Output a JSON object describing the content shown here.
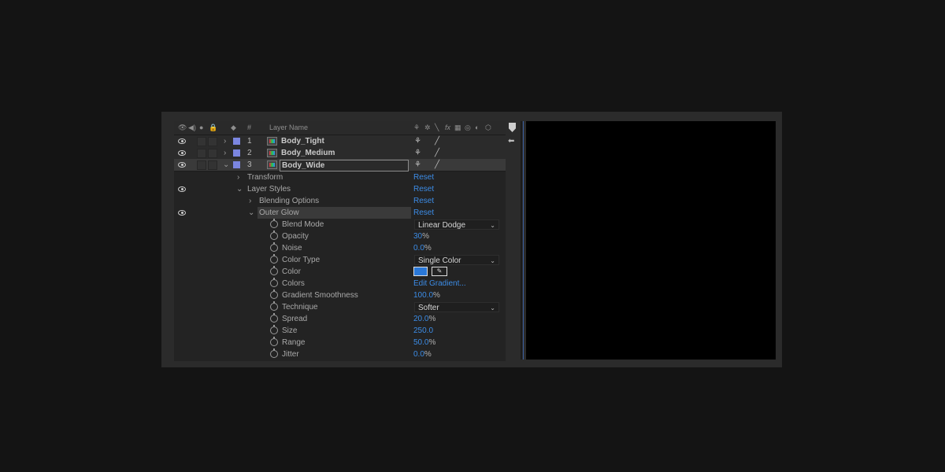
{
  "header": {
    "eye_icon": "eye-icon",
    "audio_icon": "speaker-icon",
    "solo_icon": "solo-dot-icon",
    "lock_icon": "lock-icon",
    "label_icon": "tag-icon",
    "number_col": "#",
    "layer_name_col": "Layer Name",
    "switch_icons": [
      "shy-icon",
      "collapse-icon",
      "quality-icon",
      "fx",
      "frame-blend-icon",
      "motion-blur-icon",
      "adjustment-icon",
      "3d-icon"
    ]
  },
  "layers": [
    {
      "index": "1",
      "name": "Body_Tight",
      "label_color": "#7b86e0",
      "expanded": false
    },
    {
      "index": "2",
      "name": "Body_Medium",
      "label_color": "#7b86e0",
      "expanded": false
    },
    {
      "index": "3",
      "name": "Body_Wide",
      "label_color": "#7b86e0",
      "expanded": true,
      "selected": true
    }
  ],
  "groups": {
    "transform": {
      "label": "Transform",
      "reset": "Reset"
    },
    "layer_styles": {
      "label": "Layer Styles",
      "reset": "Reset"
    },
    "blending_options": {
      "label": "Blending Options",
      "reset": "Reset"
    },
    "outer_glow": {
      "label": "Outer Glow",
      "reset": "Reset"
    }
  },
  "outer_glow_props": {
    "blend_mode": {
      "label": "Blend Mode",
      "value": "Linear Dodge"
    },
    "opacity": {
      "label": "Opacity",
      "value": "30",
      "unit": "%"
    },
    "noise": {
      "label": "Noise",
      "value": "0.0",
      "unit": "%"
    },
    "color_type": {
      "label": "Color Type",
      "value": "Single Color"
    },
    "color": {
      "label": "Color",
      "value": "#2a78d8"
    },
    "colors": {
      "label": "Colors",
      "value": "Edit Gradient..."
    },
    "gradient_smoothness": {
      "label": "Gradient Smoothness",
      "value": "100.0",
      "unit": "%"
    },
    "technique": {
      "label": "Technique",
      "value": "Softer"
    },
    "spread": {
      "label": "Spread",
      "value": "20.0",
      "unit": "%"
    },
    "size": {
      "label": "Size",
      "value": "250.0"
    },
    "range": {
      "label": "Range",
      "value": "50.0",
      "unit": "%"
    },
    "jitter": {
      "label": "Jitter",
      "value": "0.0",
      "unit": "%"
    }
  },
  "colors": {
    "accent_value": "#3c8ce6",
    "label_purple": "#7b86e0",
    "glow_color": "#2a78d8"
  }
}
